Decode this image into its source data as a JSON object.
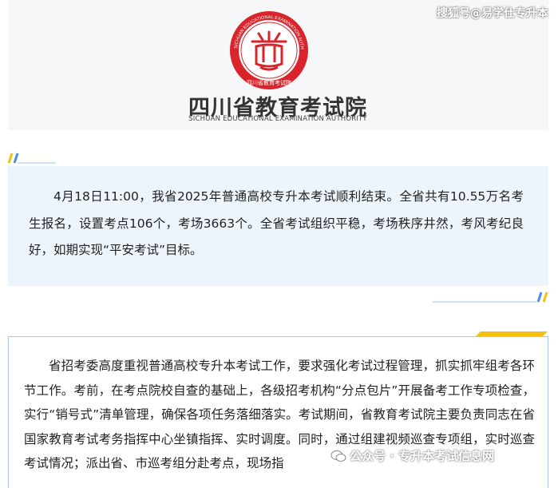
{
  "header": {
    "watermark_top": "搜狐号@易学仕专升本",
    "logo_cn": "四川省教育考试院",
    "logo_en": "SICHUAN EDUCATIONAL EXAMINATION AUTHORITY",
    "seal_ring_text": "SICHUAN EDUCATIONAL EXAMINATION AUTHORITY",
    "seal_bottom_text": "四川省教育考试院"
  },
  "info": {
    "paragraph": "4月18日11:00，我省2025年普通高校专升本考试顺利结束。全省共有10.55万名考生报名，设置考点106个，考场3663个。全省考试组织平稳，考场秩序井然，考风考纪良好，如期实现“平安考试”目标。"
  },
  "notice": {
    "paragraph": "省招考委高度重视普通高校专升本考试工作，要求强化考试过程管理，抓实抓牢组考各环节工作。考前，在考点院校自查的基础上，各级招考机构“分点包片”开展备考工作专项检查，实行“销号式”清单管理，确保各项任务落细落实。考试期间，省教育考试院主要负责同志在省国家教育考试考务指挥中心坐镇指挥、实时调度。同时，通过组建视频巡查专项组，实时巡查考试情况；派出省、市巡考组分赴考点，现场指"
  },
  "watermark_bottom": "公众号 · 专升本考试信息网",
  "colors": {
    "seal_red": "#d8242a",
    "info_bg": "#eef4fb",
    "accent_yellow": "#f4c20d",
    "accent_blue": "#4a8fe0"
  }
}
